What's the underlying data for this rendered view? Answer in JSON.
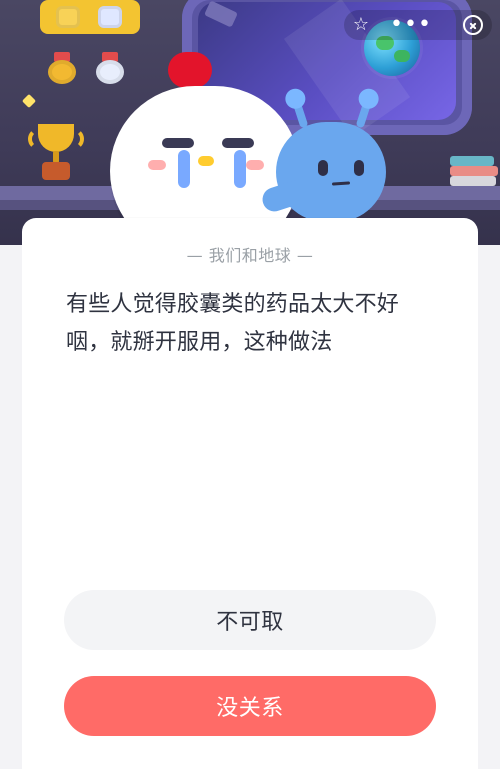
{
  "header": {
    "controls": {
      "favorite_icon": "star-icon",
      "more_label": "•••",
      "close_icon": "close-circle-icon"
    }
  },
  "quiz": {
    "category": "— 我们和地球 —",
    "question": "有些人觉得胶囊类的药品太大不好咽，就掰开服用，这种做法",
    "options": [
      {
        "label": "不可取"
      },
      {
        "label": "没关系"
      }
    ]
  },
  "colors": {
    "primary_button": "#ff6b67",
    "secondary_button": "#f3f4f6",
    "text_primary": "#2f3340",
    "text_muted": "#9aa0a6"
  }
}
